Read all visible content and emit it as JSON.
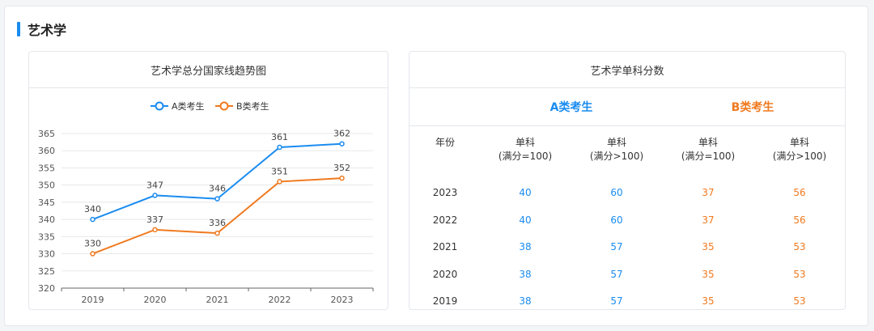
{
  "section": {
    "title": "艺术学"
  },
  "trend_card": {
    "title": "艺术学总分国家线趋势图"
  },
  "table_card": {
    "title": "艺术学单科分数",
    "group_a": "A类考生",
    "group_b": "B类考生",
    "headers": [
      {
        "line1": "年份",
        "line2": ""
      },
      {
        "line1": "单科",
        "line2": "(满分=100)"
      },
      {
        "line1": "单科",
        "line2": "(满分>100)"
      },
      {
        "line1": "单科",
        "line2": "(满分=100)"
      },
      {
        "line1": "单科",
        "line2": "(满分>100)"
      }
    ],
    "rows": [
      {
        "year": "2023",
        "a1": "40",
        "a2": "60",
        "b1": "37",
        "b2": "56"
      },
      {
        "year": "2022",
        "a1": "40",
        "a2": "60",
        "b1": "37",
        "b2": "56"
      },
      {
        "year": "2021",
        "a1": "38",
        "a2": "57",
        "b1": "35",
        "b2": "53"
      },
      {
        "year": "2020",
        "a1": "38",
        "a2": "57",
        "b1": "35",
        "b2": "53"
      },
      {
        "year": "2019",
        "a1": "38",
        "a2": "57",
        "b1": "35",
        "b2": "53"
      }
    ]
  },
  "colors": {
    "a": "#1a8cf0",
    "b": "#f07a20"
  },
  "chart_data": {
    "type": "line",
    "title": "艺术学总分国家线趋势图",
    "xlabel": "",
    "ylabel": "",
    "categories": [
      "2019",
      "2020",
      "2021",
      "2022",
      "2023"
    ],
    "series": [
      {
        "name": "A类考生",
        "values": [
          340,
          347,
          346,
          361,
          362
        ]
      },
      {
        "name": "B类考生",
        "values": [
          330,
          337,
          336,
          351,
          352
        ]
      }
    ],
    "ylim": [
      320,
      365
    ],
    "yticks": [
      320,
      325,
      330,
      335,
      340,
      345,
      350,
      355,
      360,
      365
    ],
    "grid": true,
    "legend_position": "top-center",
    "data_labels": true
  }
}
